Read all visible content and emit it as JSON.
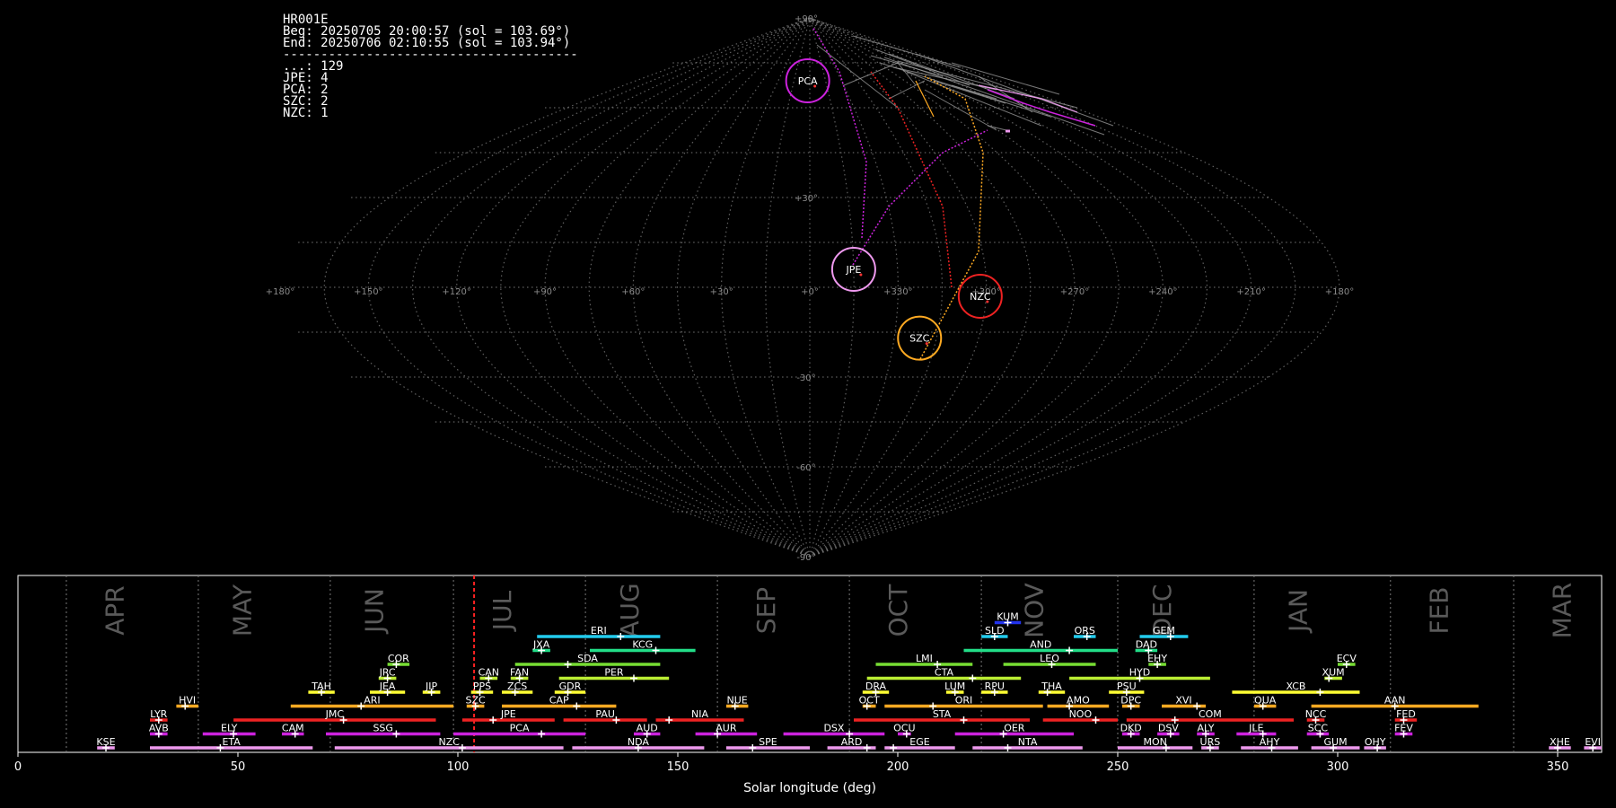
{
  "info": {
    "station": "HR001E",
    "beg": "Beg: 20250705 20:00:57 (sol = 103.69°)",
    "end": "End: 20250706 02:10:55 (sol = 103.94°)",
    "separator": "---------------------------------------",
    "counts": [
      {
        "label": "...",
        "count": "129"
      },
      {
        "label": "JPE",
        "count": "4"
      },
      {
        "label": "PCA",
        "count": "2"
      },
      {
        "label": "SZC",
        "count": "2"
      },
      {
        "label": "NZC",
        "count": "1"
      }
    ]
  },
  "colors": {
    "PCA": "#cc22dd",
    "JPE": "#ee99ee",
    "NZC": "#ee2222",
    "SZC": "#ffaa22",
    "sporadic": "#aaaaaa",
    "grid": "#777777"
  },
  "sky_map": {
    "projection": "sinusoidal",
    "ra_ticks": [
      "+180°",
      "+150°",
      "+120°",
      "+90°",
      "+60°",
      "+30°",
      "+0°",
      "+330°",
      "+300°",
      "+270°",
      "+240°",
      "+210°",
      "+180°"
    ],
    "ra_values": [
      180,
      150,
      120,
      90,
      60,
      30,
      0,
      330,
      300,
      270,
      240,
      210,
      180
    ],
    "dec_ticks": [
      {
        "label": "+90°",
        "value": 90
      },
      {
        "label": "+30°",
        "value": 30
      },
      {
        "label": "-30°",
        "value": -30
      },
      {
        "label": "-60°",
        "value": -60
      },
      {
        "label": "-90°",
        "value": -90
      }
    ],
    "showers": [
      {
        "code": "PCA",
        "ra": 2,
        "dec": 69,
        "color": "#cc22dd"
      },
      {
        "code": "JPE",
        "ra": 345,
        "dec": 6,
        "color": "#ee99ee"
      },
      {
        "code": "NZC",
        "ra": 302,
        "dec": -3,
        "color": "#ee2222"
      },
      {
        "code": "SZC",
        "ra": 321,
        "dec": -17,
        "color": "#ffaa22"
      }
    ]
  },
  "chart_data": {
    "type": "timeline",
    "xlabel": "Solar longitude (deg)",
    "xlim": [
      0,
      360
    ],
    "x_ticks": [
      0,
      50,
      100,
      150,
      200,
      250,
      300,
      350
    ],
    "current_sol": 103.69,
    "months": [
      {
        "label": "APR",
        "sol": 24,
        "boundary": 11
      },
      {
        "label": "MAY",
        "sol": 53,
        "boundary": 41
      },
      {
        "label": "JUN",
        "sol": 83,
        "boundary": 71
      },
      {
        "label": "JUL",
        "sol": 112,
        "boundary": 99
      },
      {
        "label": "AUG",
        "sol": 141,
        "boundary": 129
      },
      {
        "label": "SEP",
        "sol": 172,
        "boundary": 159
      },
      {
        "label": "OCT",
        "sol": 202,
        "boundary": 189
      },
      {
        "label": "NOV",
        "sol": 233,
        "boundary": 219
      },
      {
        "label": "DEC",
        "sol": 262,
        "boundary": 250
      },
      {
        "label": "JAN",
        "sol": 293,
        "boundary": 281
      },
      {
        "label": "FEB",
        "sol": 325,
        "boundary": 312
      },
      {
        "label": "MAR",
        "sol": 353,
        "boundary": 340
      }
    ],
    "showers": [
      {
        "code": "KSE",
        "start": 18,
        "end": 22,
        "peak": 20,
        "row": 0,
        "color": "#ee99ee"
      },
      {
        "code": "ETA",
        "start": 30,
        "end": 67,
        "peak": 46,
        "row": 0,
        "color": "#ee99ee"
      },
      {
        "code": "NZC",
        "start": 72,
        "end": 124,
        "peak": 101,
        "row": 0,
        "color": "#ee99ee"
      },
      {
        "code": "NDA",
        "start": 126,
        "end": 156,
        "peak": 141,
        "row": 0,
        "color": "#ee99ee"
      },
      {
        "code": "SPE",
        "start": 161,
        "end": 180,
        "peak": 167,
        "row": 0,
        "color": "#ee99ee"
      },
      {
        "code": "ARD",
        "start": 184,
        "end": 195,
        "peak": 193,
        "row": 0,
        "color": "#ee99ee"
      },
      {
        "code": "EGE",
        "start": 197,
        "end": 213,
        "peak": 199,
        "row": 0,
        "color": "#ee99ee"
      },
      {
        "code": "NTA",
        "start": 217,
        "end": 242,
        "peak": 225,
        "row": 0,
        "color": "#ee99ee"
      },
      {
        "code": "MON",
        "start": 250,
        "end": 267,
        "peak": 261,
        "row": 0,
        "color": "#ee99ee"
      },
      {
        "code": "URS",
        "start": 269,
        "end": 273,
        "peak": 271,
        "row": 0,
        "color": "#ee99ee"
      },
      {
        "code": "AHY",
        "start": 278,
        "end": 291,
        "peak": 285,
        "row": 0,
        "color": "#ee99ee"
      },
      {
        "code": "GUM",
        "start": 294,
        "end": 305,
        "peak": 299,
        "row": 0,
        "color": "#ee99ee"
      },
      {
        "code": "OHY",
        "start": 306,
        "end": 311,
        "peak": 309,
        "row": 0,
        "color": "#ee99ee"
      },
      {
        "code": "XHE",
        "start": 348,
        "end": 353,
        "peak": 350,
        "row": 0,
        "color": "#ee99ee"
      },
      {
        "code": "EVI",
        "start": 356,
        "end": 360,
        "peak": 358,
        "row": 0,
        "color": "#ee99ee"
      },
      {
        "code": "AVB",
        "start": 30,
        "end": 34,
        "peak": 32,
        "row": 1,
        "color": "#cc22dd"
      },
      {
        "code": "ELY",
        "start": 42,
        "end": 54,
        "peak": 49,
        "row": 1,
        "color": "#cc22dd"
      },
      {
        "code": "CAM",
        "start": 60,
        "end": 65,
        "peak": 63,
        "row": 1,
        "color": "#cc22dd"
      },
      {
        "code": "SSG",
        "start": 70,
        "end": 96,
        "peak": 86,
        "row": 1,
        "color": "#cc22dd"
      },
      {
        "code": "PCA",
        "start": 99,
        "end": 129,
        "peak": 119,
        "row": 1,
        "color": "#cc22dd"
      },
      {
        "code": "AUD",
        "start": 140,
        "end": 146,
        "peak": 143,
        "row": 1,
        "color": "#cc22dd"
      },
      {
        "code": "AUR",
        "start": 154,
        "end": 168,
        "peak": 159,
        "row": 1,
        "color": "#cc22dd"
      },
      {
        "code": "DSX",
        "start": 174,
        "end": 197,
        "peak": 189,
        "row": 1,
        "color": "#cc22dd"
      },
      {
        "code": "OCU",
        "start": 200,
        "end": 203,
        "peak": 202,
        "row": 1,
        "color": "#cc22dd"
      },
      {
        "code": "OER",
        "start": 213,
        "end": 240,
        "peak": 224,
        "row": 1,
        "color": "#cc22dd"
      },
      {
        "code": "DKD",
        "start": 251,
        "end": 255,
        "peak": 253,
        "row": 1,
        "color": "#cc22dd"
      },
      {
        "code": "DSV",
        "start": 259,
        "end": 264,
        "peak": 262,
        "row": 1,
        "color": "#cc22dd"
      },
      {
        "code": "ALY",
        "start": 268,
        "end": 272,
        "peak": 270,
        "row": 1,
        "color": "#cc22dd"
      },
      {
        "code": "JLE",
        "start": 277,
        "end": 286,
        "peak": 283,
        "row": 1,
        "color": "#cc22dd"
      },
      {
        "code": "SCC",
        "start": 293,
        "end": 298,
        "peak": 296,
        "row": 1,
        "color": "#cc22dd"
      },
      {
        "code": "FEV",
        "start": 313,
        "end": 317,
        "peak": 315,
        "row": 1,
        "color": "#cc22dd"
      },
      {
        "code": "LYR",
        "start": 30,
        "end": 34,
        "peak": 32,
        "row": 2,
        "color": "#ee2222"
      },
      {
        "code": "JMC",
        "start": 49,
        "end": 95,
        "peak": 74,
        "row": 2,
        "color": "#ee2222"
      },
      {
        "code": "JPE",
        "start": 101,
        "end": 122,
        "peak": 108,
        "row": 2,
        "color": "#ee2222"
      },
      {
        "code": "PAU",
        "start": 124,
        "end": 143,
        "peak": 136,
        "row": 2,
        "color": "#ee2222"
      },
      {
        "code": "NIA",
        "start": 145,
        "end": 165,
        "peak": 148,
        "row": 2,
        "color": "#ee2222"
      },
      {
        "code": "STA",
        "start": 190,
        "end": 230,
        "peak": 215,
        "row": 2,
        "color": "#ee2222"
      },
      {
        "code": "NOO",
        "start": 233,
        "end": 250,
        "peak": 245,
        "row": 2,
        "color": "#ee2222"
      },
      {
        "code": "COM",
        "start": 252,
        "end": 290,
        "peak": 263,
        "row": 2,
        "color": "#ee2222"
      },
      {
        "code": "NCC",
        "start": 293,
        "end": 297,
        "peak": 295,
        "row": 2,
        "color": "#ee2222"
      },
      {
        "code": "FED",
        "start": 313,
        "end": 318,
        "peak": 315,
        "row": 2,
        "color": "#ee2222"
      },
      {
        "code": "HVI",
        "start": 36,
        "end": 41,
        "peak": 38,
        "row": 3,
        "color": "#ffaa22"
      },
      {
        "code": "ARI",
        "start": 62,
        "end": 99,
        "peak": 78,
        "row": 3,
        "color": "#ffaa22"
      },
      {
        "code": "SZC",
        "start": 102,
        "end": 106,
        "peak": 104,
        "row": 3,
        "color": "#ffaa22"
      },
      {
        "code": "CAP",
        "start": 110,
        "end": 136,
        "peak": 127,
        "row": 3,
        "color": "#ffaa22"
      },
      {
        "code": "NUE",
        "start": 161,
        "end": 166,
        "peak": 163,
        "row": 3,
        "color": "#ffaa22"
      },
      {
        "code": "OCT",
        "start": 192,
        "end": 195,
        "peak": 193,
        "row": 3,
        "color": "#ffaa22"
      },
      {
        "code": "ORI",
        "start": 197,
        "end": 233,
        "peak": 208,
        "row": 3,
        "color": "#ffaa22"
      },
      {
        "code": "AMO",
        "start": 234,
        "end": 248,
        "peak": 239,
        "row": 3,
        "color": "#ffaa22"
      },
      {
        "code": "DPC",
        "start": 251,
        "end": 255,
        "peak": 253,
        "row": 3,
        "color": "#ffaa22"
      },
      {
        "code": "XVI",
        "start": 260,
        "end": 270,
        "peak": 268,
        "row": 3,
        "color": "#ffaa22"
      },
      {
        "code": "QUA",
        "start": 281,
        "end": 286,
        "peak": 283,
        "row": 3,
        "color": "#ffaa22"
      },
      {
        "code": "AAN",
        "start": 294,
        "end": 332,
        "peak": 313,
        "row": 3,
        "color": "#ffaa22"
      },
      {
        "code": "TAH",
        "start": 66,
        "end": 72,
        "peak": 69,
        "row": 4,
        "color": "#ffff33"
      },
      {
        "code": "JEA",
        "start": 80,
        "end": 88,
        "peak": 84,
        "row": 4,
        "color": "#ffff33"
      },
      {
        "code": "JIP",
        "start": 92,
        "end": 96,
        "peak": 94,
        "row": 4,
        "color": "#ffff33"
      },
      {
        "code": "PPS",
        "start": 103,
        "end": 108,
        "peak": 105,
        "row": 4,
        "color": "#ffff33"
      },
      {
        "code": "ZCS",
        "start": 110,
        "end": 117,
        "peak": 113,
        "row": 4,
        "color": "#ffff33"
      },
      {
        "code": "GDR",
        "start": 122,
        "end": 129,
        "peak": 125,
        "row": 4,
        "color": "#ffff33"
      },
      {
        "code": "DRA",
        "start": 192,
        "end": 198,
        "peak": 195,
        "row": 4,
        "color": "#ffff33"
      },
      {
        "code": "LUM",
        "start": 211,
        "end": 215,
        "peak": 213,
        "row": 4,
        "color": "#ffff33"
      },
      {
        "code": "RPU",
        "start": 219,
        "end": 225,
        "peak": 222,
        "row": 4,
        "color": "#ffff33"
      },
      {
        "code": "THA",
        "start": 232,
        "end": 238,
        "peak": 234,
        "row": 4,
        "color": "#ffff33"
      },
      {
        "code": "PSU",
        "start": 248,
        "end": 256,
        "peak": 252,
        "row": 4,
        "color": "#ffff33"
      },
      {
        "code": "XCB",
        "start": 276,
        "end": 305,
        "peak": 296,
        "row": 4,
        "color": "#ffff33"
      },
      {
        "code": "JRC",
        "start": 82,
        "end": 86,
        "peak": 84,
        "row": 5,
        "color": "#bbee33"
      },
      {
        "code": "CAN",
        "start": 105,
        "end": 109,
        "peak": 107,
        "row": 5,
        "color": "#bbee33"
      },
      {
        "code": "FAN",
        "start": 112,
        "end": 116,
        "peak": 114,
        "row": 5,
        "color": "#bbee33"
      },
      {
        "code": "PER",
        "start": 123,
        "end": 148,
        "peak": 140,
        "row": 5,
        "color": "#bbee33"
      },
      {
        "code": "CTA",
        "start": 193,
        "end": 228,
        "peak": 217,
        "row": 5,
        "color": "#bbee33"
      },
      {
        "code": "HYD",
        "start": 239,
        "end": 271,
        "peak": 255,
        "row": 5,
        "color": "#bbee33"
      },
      {
        "code": "XUM",
        "start": 297,
        "end": 301,
        "peak": 298,
        "row": 5,
        "color": "#bbee33"
      },
      {
        "code": "COR",
        "start": 84,
        "end": 89,
        "peak": 86,
        "row": 6,
        "color": "#77dd33"
      },
      {
        "code": "SDA",
        "start": 113,
        "end": 146,
        "peak": 125,
        "row": 6,
        "color": "#77dd33"
      },
      {
        "code": "LMI",
        "start": 195,
        "end": 217,
        "peak": 209,
        "row": 6,
        "color": "#77dd33"
      },
      {
        "code": "LEO",
        "start": 224,
        "end": 245,
        "peak": 235,
        "row": 6,
        "color": "#77dd33"
      },
      {
        "code": "EHY",
        "start": 257,
        "end": 261,
        "peak": 259,
        "row": 6,
        "color": "#77dd33"
      },
      {
        "code": "ECV",
        "start": 300,
        "end": 304,
        "peak": 302,
        "row": 6,
        "color": "#77dd33"
      },
      {
        "code": "JXA",
        "start": 117,
        "end": 121,
        "peak": 119,
        "row": 7,
        "color": "#22dd88"
      },
      {
        "code": "KCG",
        "start": 130,
        "end": 154,
        "peak": 145,
        "row": 7,
        "color": "#22dd88"
      },
      {
        "code": "AND",
        "start": 215,
        "end": 250,
        "peak": 239,
        "row": 7,
        "color": "#22dd88"
      },
      {
        "code": "DAD",
        "start": 254,
        "end": 259,
        "peak": 257,
        "row": 7,
        "color": "#22dd88"
      },
      {
        "code": "ERI",
        "start": 118,
        "end": 146,
        "peak": 137,
        "row": 8,
        "color": "#22ccee"
      },
      {
        "code": "SLD",
        "start": 219,
        "end": 225,
        "peak": 222,
        "row": 8,
        "color": "#22ccee"
      },
      {
        "code": "ORS",
        "start": 240,
        "end": 245,
        "peak": 243,
        "row": 8,
        "color": "#22ccee"
      },
      {
        "code": "GEM",
        "start": 255,
        "end": 266,
        "peak": 262,
        "row": 8,
        "color": "#22ccee"
      },
      {
        "code": "KUM",
        "start": 222,
        "end": 228,
        "peak": 225,
        "row": 9,
        "color": "#2233ee"
      }
    ]
  }
}
